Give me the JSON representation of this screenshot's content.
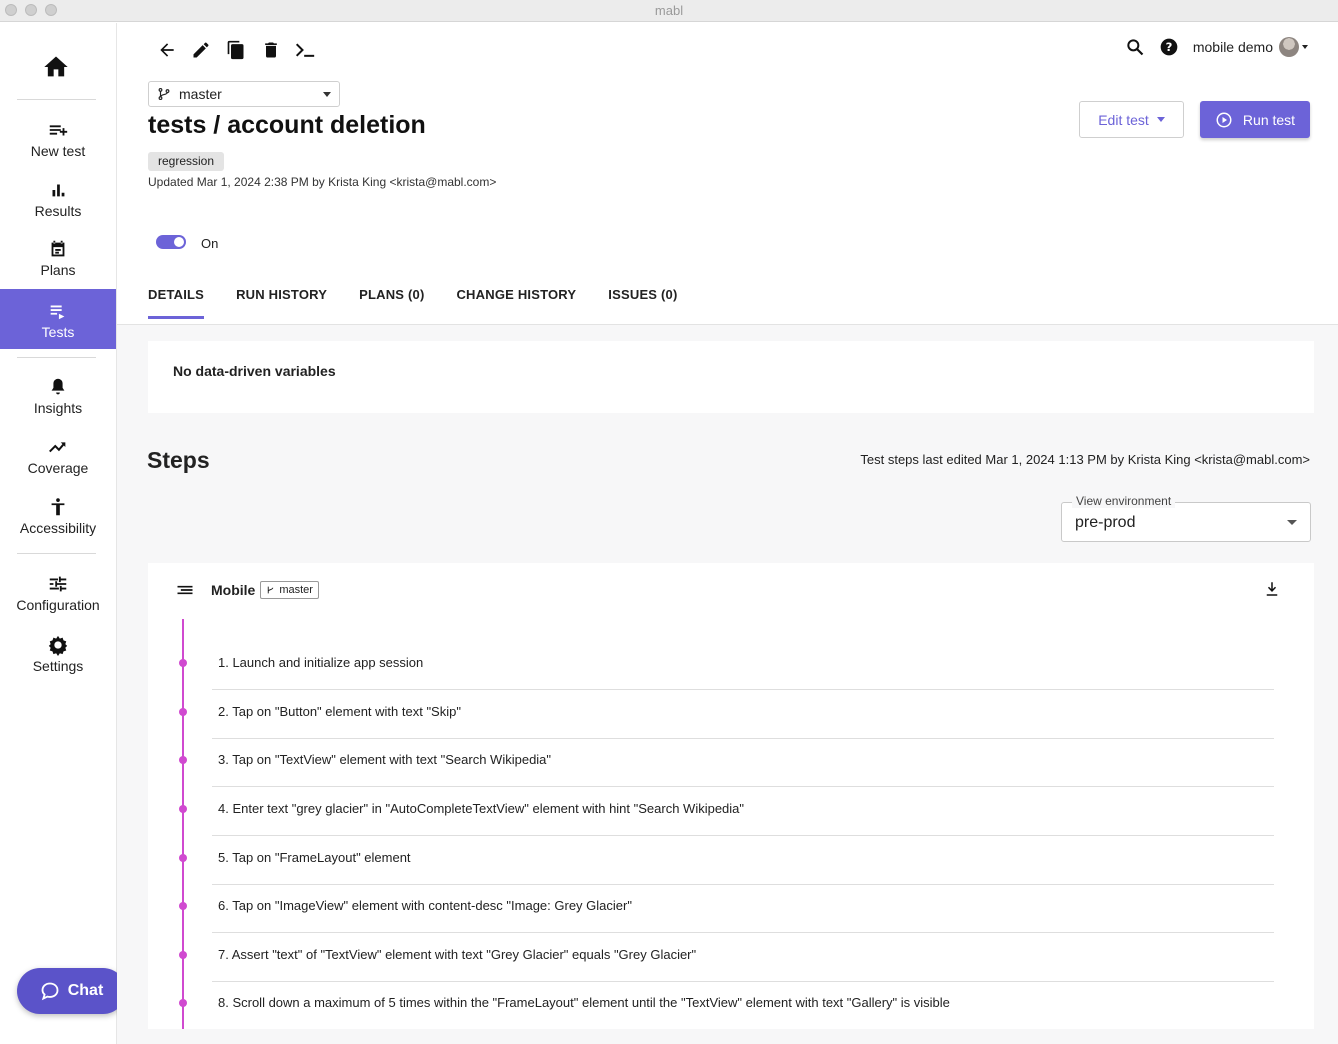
{
  "window": {
    "title": "mabl"
  },
  "sidebar": {
    "items": [
      {
        "label": "New test",
        "icon": "new-test-icon"
      },
      {
        "label": "Results",
        "icon": "bar-chart-icon"
      },
      {
        "label": "Plans",
        "icon": "calendar-icon"
      },
      {
        "label": "Tests",
        "icon": "tests-list-icon",
        "active": true
      },
      {
        "label": "Insights",
        "icon": "bell-icon"
      },
      {
        "label": "Coverage",
        "icon": "trending-up-icon"
      },
      {
        "label": "Accessibility",
        "icon": "accessibility-icon"
      },
      {
        "label": "Configuration",
        "icon": "sliders-icon"
      },
      {
        "label": "Settings",
        "icon": "gear-icon"
      }
    ],
    "chat_label": "Chat"
  },
  "header": {
    "user_name": "mobile demo",
    "branch": "master",
    "title": "tests / account deletion",
    "tag": "regression",
    "updated": "Updated Mar 1, 2024 2:38 PM by Krista King <krista@mabl.com>",
    "edit_label": "Edit test",
    "run_label": "Run test",
    "toggle_label": "On"
  },
  "tabs": [
    {
      "label": "DETAILS",
      "active": true
    },
    {
      "label": "RUN HISTORY"
    },
    {
      "label": "PLANS (0)"
    },
    {
      "label": "CHANGE HISTORY"
    },
    {
      "label": "ISSUES (0)"
    }
  ],
  "details": {
    "no_vars": "No data-driven variables",
    "steps_title": "Steps",
    "steps_edited": "Test steps last edited Mar 1, 2024 1:13 PM by Krista King <krista@mabl.com>",
    "environment_label": "View environment",
    "environment_value": "pre-prod"
  },
  "flow": {
    "name": "Mobile",
    "branch": "master",
    "steps": [
      "1. Launch and initialize app session",
      "2. Tap on \"Button\" element with text \"Skip\"",
      "3. Tap on \"TextView\" element with text \"Search Wikipedia\"",
      "4. Enter text \"grey glacier\" in \"AutoCompleteTextView\" element with hint \"Search Wikipedia\"",
      "5. Tap on \"FrameLayout\" element",
      "6. Tap on \"ImageView\" element with content-desc \"Image: Grey Glacier\"",
      "7. Assert \"text\" of \"TextView\" element with text \"Grey Glacier\" equals \"Grey Glacier\"",
      "8. Scroll down a maximum of 5 times within the \"FrameLayout\" element until the \"TextView\" element with text \"Gallery\" is visible"
    ]
  },
  "colors": {
    "accent": "#6c63d8",
    "timeline": "#d04ad0",
    "chat": "#5b53c9"
  }
}
